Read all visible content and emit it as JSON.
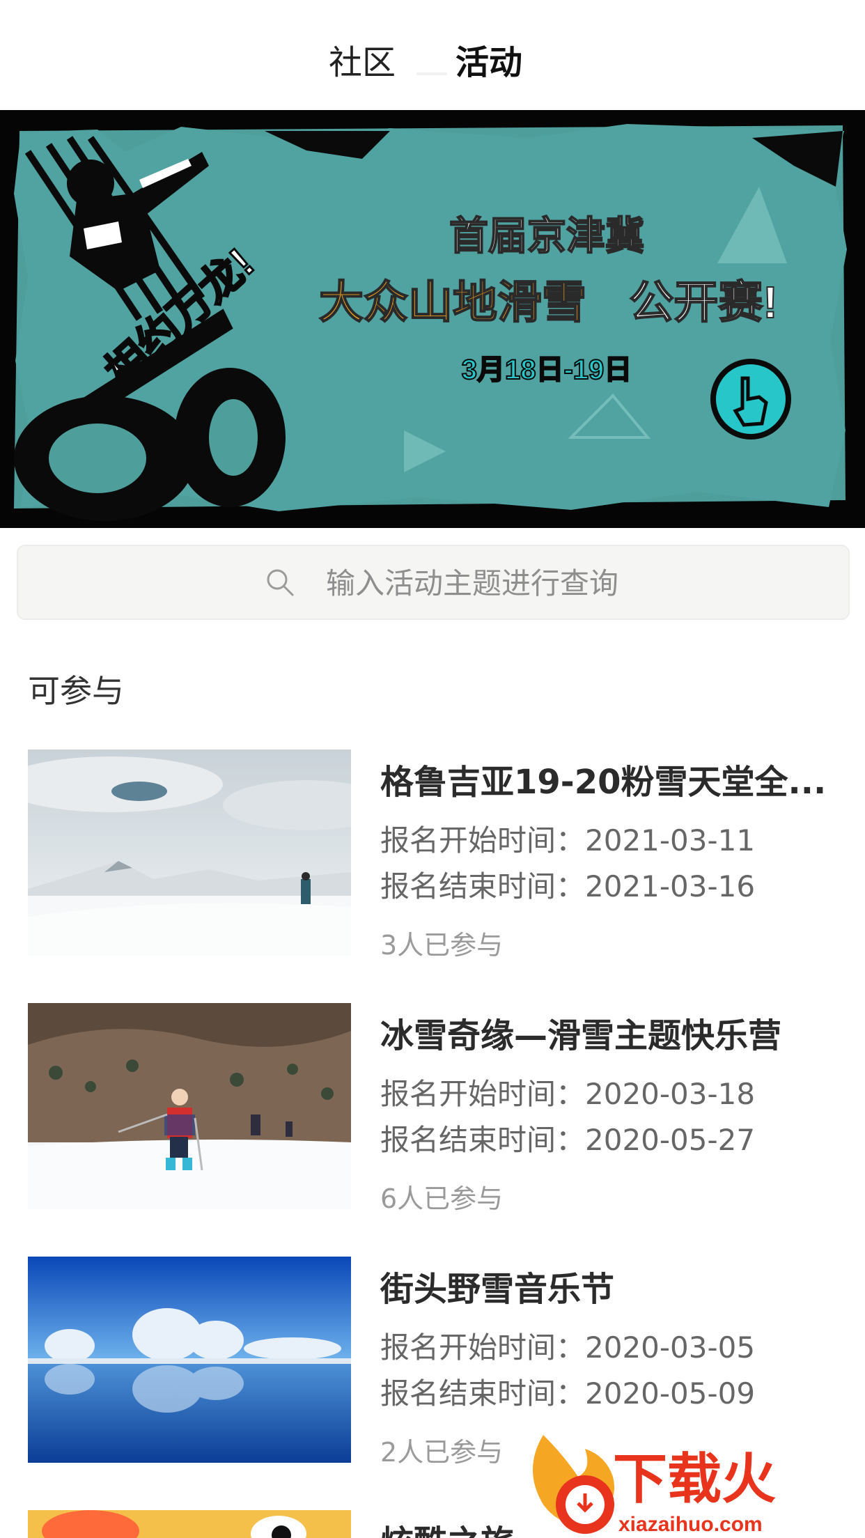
{
  "tabs": [
    {
      "label": "社区",
      "active": false
    },
    {
      "label": "活动",
      "active": true
    }
  ],
  "banner": {
    "line1": "首届京津冀",
    "line2_highlight": "大众山地滑雪",
    "line2_rest": "公开赛!",
    "dates": "3月18日-19日",
    "slogan": "相约万龙!",
    "colors": {
      "background": "#4e9e9c",
      "frame": "#050505",
      "highlight": "#f2a11f",
      "cyan": "#27c6c9"
    }
  },
  "search": {
    "placeholder": "输入活动主题进行查询"
  },
  "section": {
    "title": "可参与"
  },
  "activities": [
    {
      "title": "格鲁吉亚19-20粉雪天堂全...",
      "start": "报名开始时间：2021-03-11",
      "end": "报名结束时间：2021-03-16",
      "count": "3人已参与"
    },
    {
      "title": "冰雪奇缘—滑雪主题快乐营",
      "start": "报名开始时间：2020-03-18",
      "end": "报名结束时间：2020-05-27",
      "count": "6人已参与"
    },
    {
      "title": "街头野雪音乐节",
      "start": "报名开始时间：2020-03-05",
      "end": "报名结束时间：2020-05-09",
      "count": "2人已参与"
    },
    {
      "title": "炫酷之旅",
      "start": "",
      "end": "",
      "count": ""
    }
  ],
  "watermark": {
    "brand": "下载火",
    "url": "xiazaihuo.com",
    "colors": {
      "brand": "#e8341c",
      "flame": "#f5a623"
    }
  }
}
